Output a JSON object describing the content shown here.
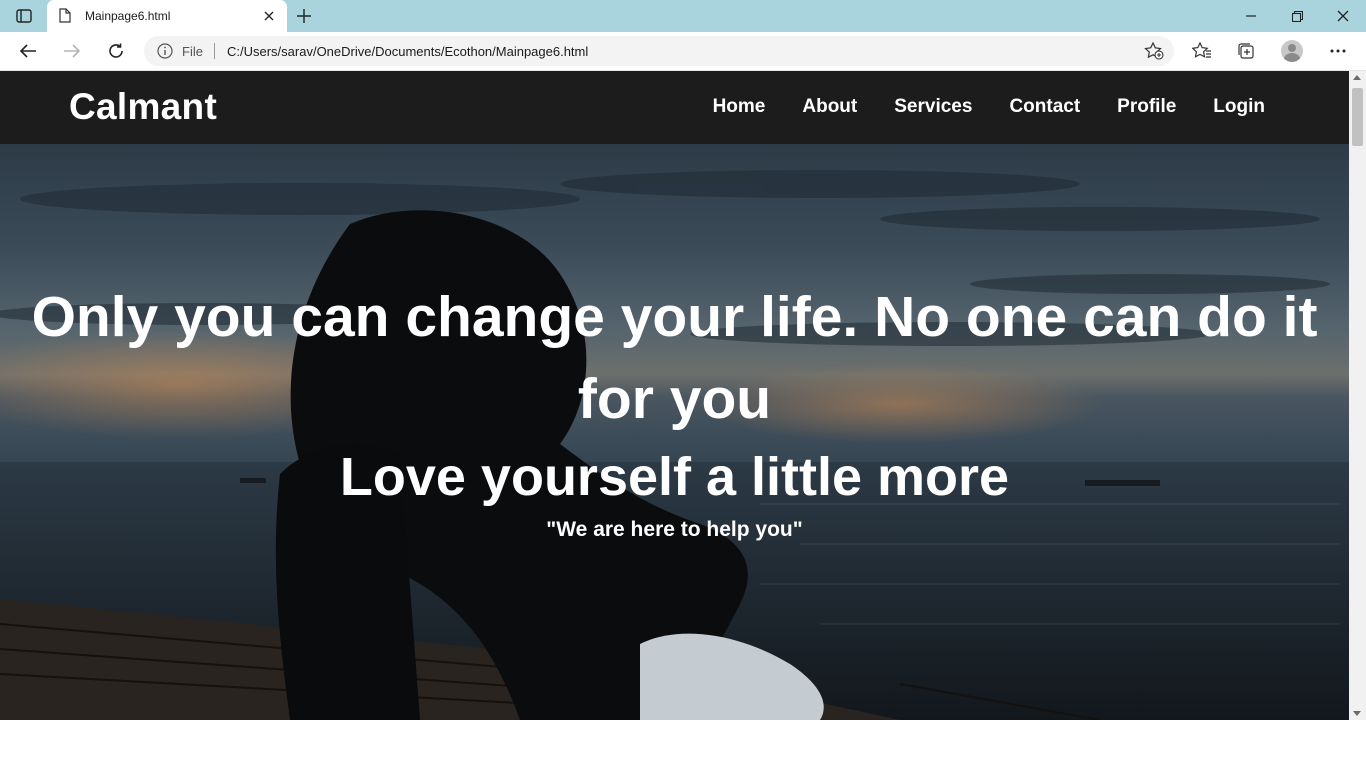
{
  "browser": {
    "tab_title": "Mainpage6.html",
    "file_label": "File",
    "url": "C:/Users/sarav/OneDrive/Documents/Ecothon/Mainpage6.html"
  },
  "site": {
    "logo": "Calmant",
    "nav": [
      "Home",
      "About",
      "Services",
      "Contact",
      "Profile",
      "Login"
    ]
  },
  "hero": {
    "quote": "Only you can change your life. No one can do it for you",
    "subheading": "Love yourself a little more",
    "tagline": "\"We are here to help you\""
  },
  "colors": {
    "tabbar": "#a9d4de",
    "navbar": "#1c1c1c",
    "text": "#ffffff"
  }
}
